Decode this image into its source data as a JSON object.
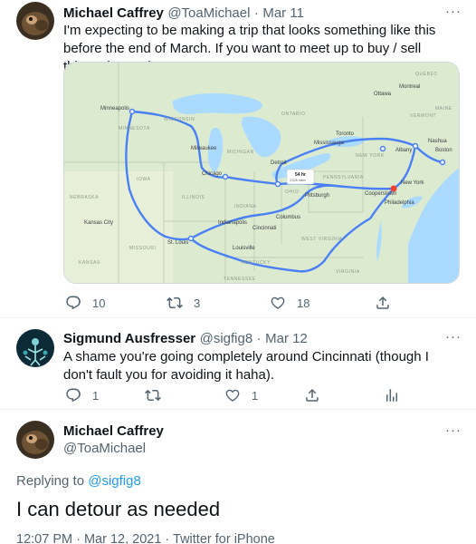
{
  "tweet1": {
    "name": "Michael Caffrey",
    "handle": "@ToaMichael",
    "dot": "·",
    "date": "Mar 11",
    "more": "···",
    "text": "I'm expecting to be making a trip that looks something like this before the end of March.  If you want to meet up to buy / sell things, let me know!",
    "replies": "10",
    "retweets": "3",
    "likes": "18",
    "map": {
      "cities": [
        "Minneapolis",
        "Milwaukee",
        "Chicago",
        "Detroit",
        "Toronto",
        "Mississauga",
        "Ottawa",
        "Montreal",
        "Albany",
        "Boston",
        "Nashua",
        "New York",
        "Philadelphia",
        "Pittsburgh",
        "Columbus",
        "Cincinnati",
        "Indianapolis",
        "Louisville",
        "St. Louis",
        "Kansas City",
        "Cooperstown"
      ],
      "states": [
        "MINNESOTA",
        "WISCONSIN",
        "MICHIGAN",
        "IOWA",
        "ILLINOIS",
        "INDIANA",
        "OHIO",
        "MISSOURI",
        "KENTUCKY",
        "PENNSYLVANIA",
        "NEW YORK",
        "ONTARIO",
        "QUEBEC",
        "NEBRASKA",
        "KANSAS",
        "TENNESSEE",
        "WEST VIRGINIA",
        "VIRGINIA",
        "MAINE",
        "VERMONT"
      ],
      "route_time": "54 hr",
      "route_distance": "3,525 miles"
    }
  },
  "tweet2": {
    "name": "Sigmund Ausfresser",
    "handle": "@sigfig8",
    "dot": "·",
    "date": "Mar 12",
    "more": "···",
    "text": "A shame you're going completely around Cincinnati (though I don't fault you for avoiding it haha).",
    "replies": "1",
    "likes": "1"
  },
  "tweet3": {
    "name": "Michael Caffrey",
    "handle": "@ToaMichael",
    "more": "···",
    "replying_prefix": "Replying to ",
    "replying_handle": "@sigfig8",
    "text": "I can detour as needed",
    "timestamp": "12:07 PM · Mar 12, 2021 · Twitter for iPhone"
  },
  "colors": {
    "accent": "#1d9bf0",
    "muted": "#536471",
    "route": "#4a80f5",
    "water": "#aadaff",
    "land": "#dcebd0"
  }
}
